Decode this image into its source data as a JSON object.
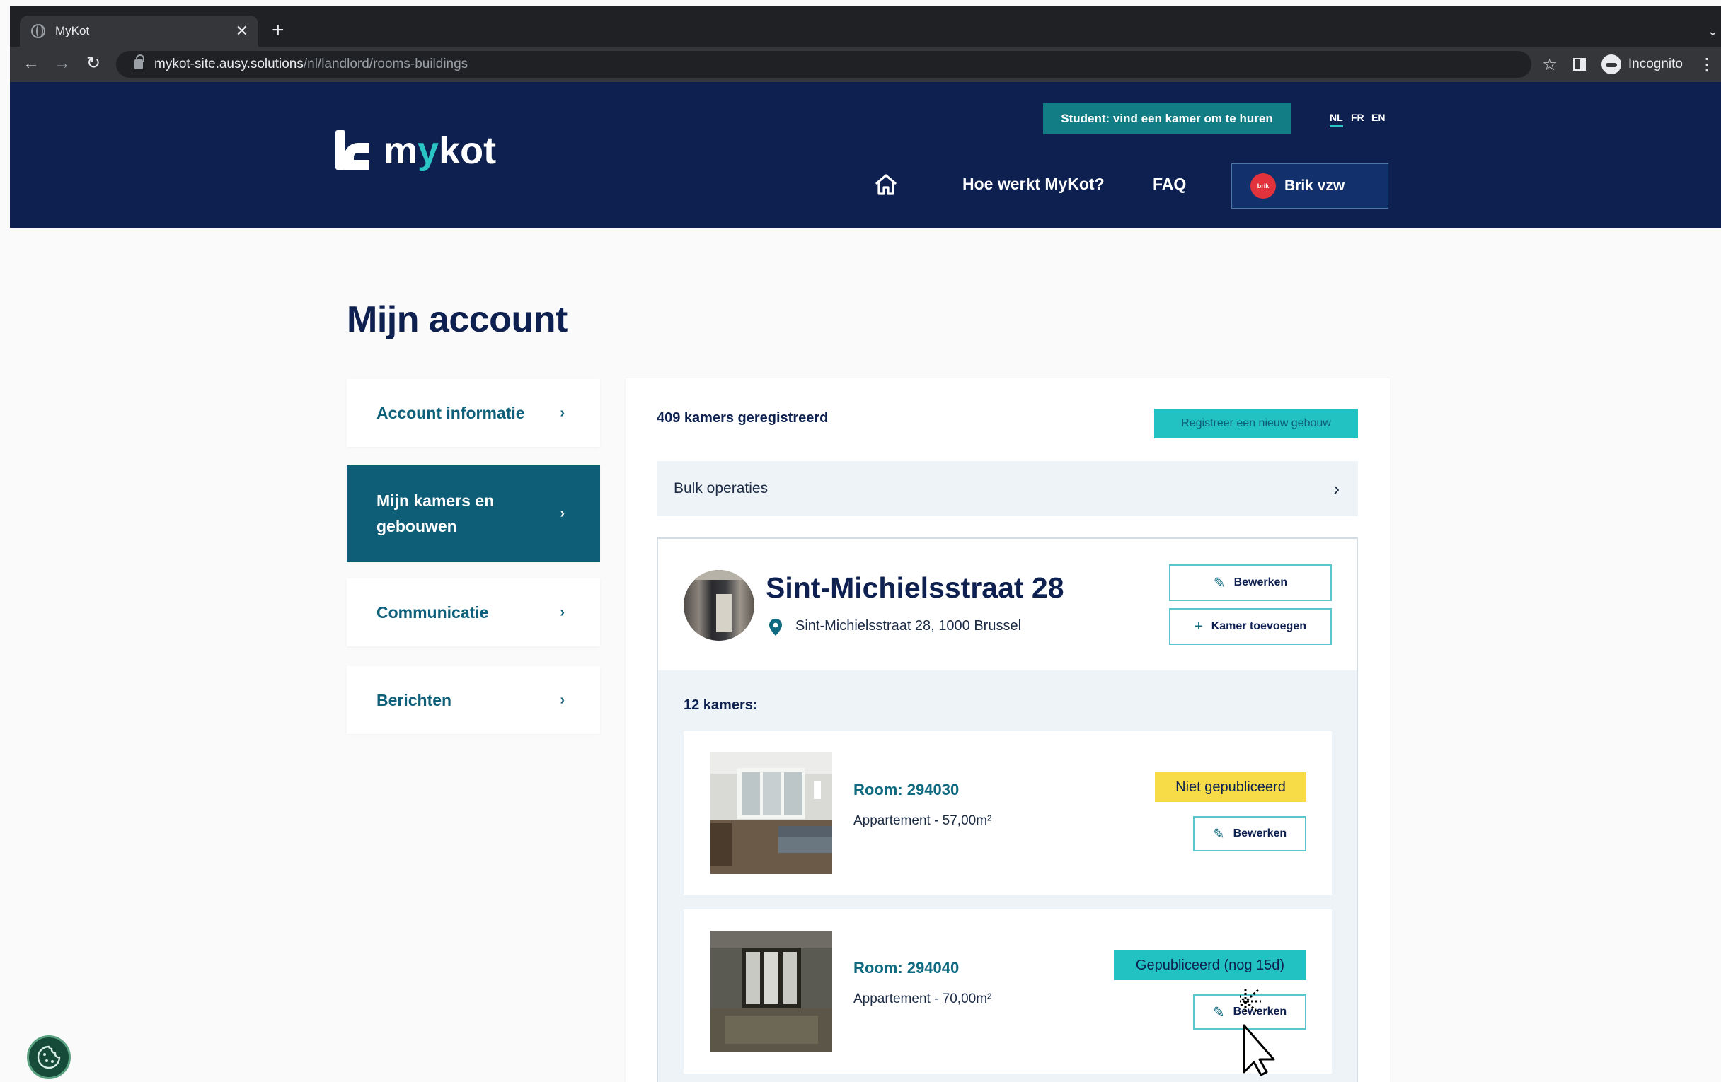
{
  "browser": {
    "tab_title": "MyKot",
    "tab_close": "✕",
    "new_tab": "+",
    "url_host": "mykot-site.ausy.solutions",
    "url_path": "/nl/landlord/rooms-buildings",
    "profile_label": "Incognito",
    "nav_back": "←",
    "nav_forward": "→",
    "nav_reload": "↻",
    "star": "☆",
    "more": "⋮"
  },
  "header": {
    "logo_text_pre": "m",
    "logo_text_y": "y",
    "logo_text_post": "kot",
    "student_button": "Student: vind een kamer om te huren",
    "languages": [
      "NL",
      "FR",
      "EN"
    ],
    "nav_how": "Hoe werkt MyKot?",
    "nav_faq": "FAQ",
    "account_name": "Brik vzw",
    "avatar_text": "brik"
  },
  "page": {
    "title": "Mijn account"
  },
  "sidebar": {
    "items": [
      {
        "label": "Account informatie",
        "chevron": "›"
      },
      {
        "label": "Mijn kamers en gebouwen",
        "chevron": "›"
      },
      {
        "label": "Communicatie",
        "chevron": "›"
      },
      {
        "label": "Berichten",
        "chevron": "›"
      }
    ]
  },
  "main": {
    "count_title": "409 kamers geregistreerd",
    "register_button": "Registreer een nieuw gebouw",
    "bulk_label": "Bulk operaties",
    "bulk_chevron": "›",
    "building": {
      "name": "Sint-Michielsstraat 28",
      "address": "Sint-Michielsstraat 28, 1000 Brussel",
      "edit_button": "Bewerken",
      "add_room_button": "Kamer toevoegen",
      "rooms_count": "12 kamers:",
      "rooms": [
        {
          "title": "Room: 294030",
          "meta": "Appartement - 57,00m²",
          "status": "Niet gepubliceerd",
          "edit": "Bewerken"
        },
        {
          "title": "Room: 294040",
          "meta": "Appartement - 70,00m²",
          "status": "Gepubliceerd (nog 15d)",
          "edit": "Bewerken"
        }
      ]
    }
  },
  "colors": {
    "navy": "#0d2050",
    "teal": "#0f5e78",
    "aqua": "#22c2c2",
    "yellow": "#f7dc48"
  },
  "icons": {
    "home": "home-icon",
    "pin": "map-pin-icon",
    "pencil": "pencil-icon",
    "plus": "plus-icon",
    "cookie": "cookie-icon"
  }
}
